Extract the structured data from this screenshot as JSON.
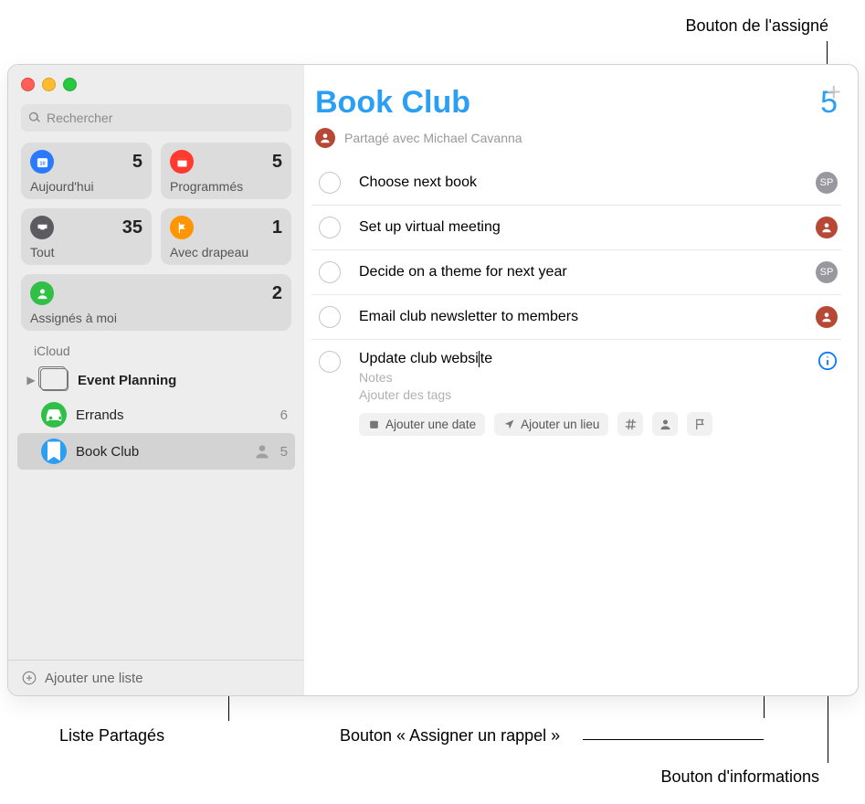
{
  "callouts": {
    "assignee_button": "Bouton de l'assigné",
    "shared_list": "Liste Partagés",
    "assign_reminder_button": "Bouton « Assigner un rappel »",
    "info_button": "Bouton d'informations"
  },
  "search": {
    "placeholder": "Rechercher"
  },
  "smart_lists": {
    "today": {
      "label": "Aujourd'hui",
      "count": "5",
      "color": "#2a7aff",
      "date_num": "10"
    },
    "scheduled": {
      "label": "Programmés",
      "count": "5",
      "color": "#ff3b30"
    },
    "all": {
      "label": "Tout",
      "count": "35",
      "color": "#5b5b60"
    },
    "flagged": {
      "label": "Avec drapeau",
      "count": "1",
      "color": "#ff9500"
    },
    "assigned": {
      "label": "Assignés à moi",
      "count": "2",
      "color": "#30c048"
    }
  },
  "account": {
    "label": "iCloud"
  },
  "lists": {
    "event_planning": {
      "name": "Event Planning"
    },
    "errands": {
      "name": "Errands",
      "count": "6",
      "color": "#30c048"
    },
    "book_club": {
      "name": "Book Club",
      "count": "5",
      "color": "#2a9ff3"
    }
  },
  "footer": {
    "add_list": "Ajouter une liste"
  },
  "main": {
    "title": "Book Club",
    "count": "5",
    "shared_with": "Partagé avec Michael Cavanna",
    "tasks": [
      {
        "title": "Choose next book",
        "assignee": "sp"
      },
      {
        "title": "Set up virtual meeting",
        "assignee": "mc"
      },
      {
        "title": "Decide on a theme for next year",
        "assignee": "sp"
      },
      {
        "title": "Email club newsletter to members",
        "assignee": "mc"
      }
    ],
    "editing": {
      "title_before": "Update club websi",
      "title_after": "te",
      "notes_placeholder": "Notes",
      "tags_placeholder": "Ajouter des tags",
      "add_date": "Ajouter une date",
      "add_location": "Ajouter un lieu"
    },
    "assignee_initials": {
      "sp": "SP"
    }
  }
}
